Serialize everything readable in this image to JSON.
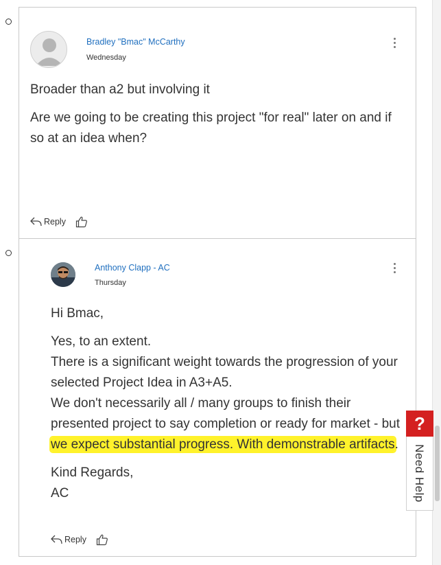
{
  "posts": [
    {
      "author": "Bradley \"Bmac\" McCarthy",
      "date": "Wednesday",
      "paragraphs": [
        "Broader than a2 but involving it",
        "Are we going to be creating this project \"for real\" later on and if so at an idea when?"
      ],
      "reply_label": "Reply"
    },
    {
      "author": "Anthony Clapp - AC",
      "date": "Thursday",
      "greeting": "Hi Bmac,",
      "body_lines": [
        "Yes, to an extent.",
        "There is a significant weight towards the progression of your selected Project Idea in A3+A5.",
        "We don't necessarily all / many groups to finish their presented project to say completion or ready for market - but "
      ],
      "highlighted": "we expect substantial progress. With demonstrable artifacts",
      "after_highlight": ".",
      "signoff_1": "Kind Regards,",
      "signoff_2": "AC",
      "reply_label": "Reply"
    }
  ],
  "help_widget": {
    "icon": "?",
    "label": "Need Help"
  },
  "colors": {
    "author_link": "#1f6fbf",
    "highlight": "#fff22b",
    "help_red": "#d42020"
  }
}
